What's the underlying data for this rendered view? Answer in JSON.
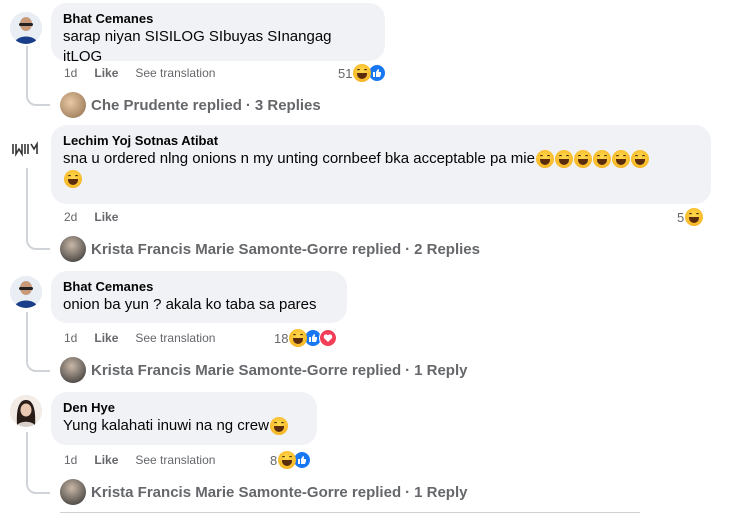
{
  "comments": [
    {
      "author": "Bhat Cemanes",
      "text": "sarap niyan SISILOG SIbuyas SInangag itLOG",
      "time": "1d",
      "like_label": "Like",
      "translate_label": "See translation",
      "react_count": "51",
      "replied_by": "Che Prudente replied",
      "replies": "3 Replies"
    },
    {
      "author": "Lechim Yoj Sotnas Atibat",
      "text": "sna u ordered nlng onions n my unting cornbeef bka acceptable pa mie",
      "time": "2d",
      "like_label": "Like",
      "react_count": "5",
      "replied_by": "Krista Francis Marie Samonte-Gorre replied",
      "replies": "2 Replies"
    },
    {
      "author": "Bhat Cemanes",
      "text": "onion ba yun ? akala ko taba sa pares",
      "time": "1d",
      "like_label": "Like",
      "translate_label": "See translation",
      "react_count": "18",
      "replied_by": "Krista Francis Marie Samonte-Gorre replied",
      "replies": "1 Reply"
    },
    {
      "author": "Den Hye",
      "text": "Yung kalahati inuwi na ng crew",
      "time": "1d",
      "like_label": "Like",
      "translate_label": "See translation",
      "react_count": "8",
      "replied_by": "Krista Francis Marie Samonte-Gorre replied",
      "replies": "1 Reply"
    }
  ],
  "separator": "·",
  "colors": {
    "bubble": "#f0f2f5",
    "meta": "#65676b",
    "like_blue": "#1877f2",
    "love_red": "#f33e58",
    "haha_yellow": "#f7b928"
  },
  "icons": {
    "haha": "haha-emoji-icon",
    "like": "like-reaction-icon",
    "love": "love-reaction-icon"
  }
}
